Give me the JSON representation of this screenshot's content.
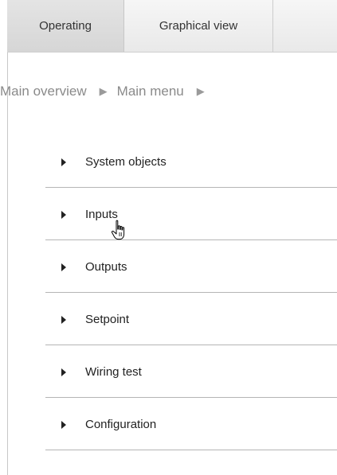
{
  "tabs": [
    {
      "label": "Operating",
      "active": true
    },
    {
      "label": "Graphical view",
      "active": false
    }
  ],
  "breadcrumb": {
    "items": [
      {
        "label": "Main overview"
      },
      {
        "label": "Main menu"
      }
    ],
    "separator": "▶"
  },
  "menu": {
    "items": [
      {
        "label": "System objects"
      },
      {
        "label": "Inputs"
      },
      {
        "label": "Outputs"
      },
      {
        "label": "Setpoint"
      },
      {
        "label": "Wiring test"
      },
      {
        "label": "Configuration"
      }
    ]
  },
  "cursor": {
    "icon": "hand-pointer-icon",
    "hovered_item": "Inputs"
  },
  "colors": {
    "active_tab": "#dcdcdc",
    "breadcrumb_text": "#8a8a8a",
    "divider": "#b5b5b5",
    "menu_text": "#222222"
  }
}
